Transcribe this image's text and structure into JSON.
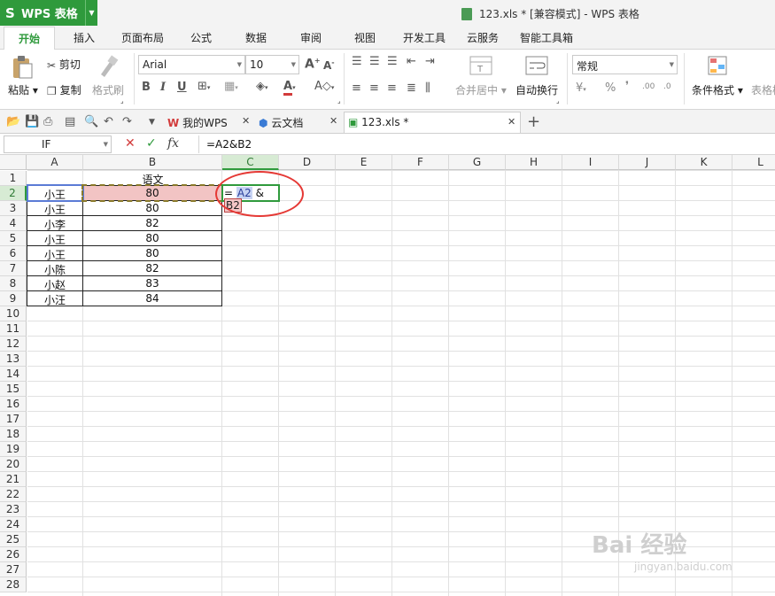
{
  "app": {
    "name": "WPS 表格",
    "logo": "S"
  },
  "window": {
    "title": "123.xls * [兼容模式] - WPS 表格"
  },
  "ribbon_tabs": [
    "开始",
    "插入",
    "页面布局",
    "公式",
    "数据",
    "审阅",
    "视图",
    "开发工具",
    "云服务",
    "智能工具箱"
  ],
  "ribbon": {
    "paste": "粘贴",
    "cut": "剪切",
    "copy": "复制",
    "format_painter": "格式刷",
    "font_name": "Arial",
    "font_size": "10",
    "merge_center": "合并居中",
    "wrap_text": "自动换行",
    "number_format": "常规",
    "conditional_format": "条件格式",
    "table_style": "表格样"
  },
  "doc_tabs": [
    {
      "label": "我的WPS"
    },
    {
      "label": "云文档"
    },
    {
      "label": "123.xls *"
    }
  ],
  "formula_bar": {
    "name_box": "IF",
    "formula": "=A2&B2",
    "fx": "fx"
  },
  "columns": [
    "A",
    "B",
    "C",
    "D",
    "E",
    "F",
    "G",
    "H",
    "I",
    "J",
    "K",
    "L"
  ],
  "rows": [
    "1",
    "2",
    "3",
    "4",
    "5",
    "6",
    "7",
    "8",
    "9",
    "10",
    "11",
    "12",
    "13",
    "14",
    "15",
    "16",
    "17",
    "18",
    "19",
    "20",
    "21",
    "22",
    "23",
    "24",
    "25",
    "26",
    "27",
    "28"
  ],
  "sheet": {
    "header_b1": "语文",
    "names": [
      "小王",
      "小王",
      "小李",
      "小王",
      "小王",
      "小陈",
      "小赵",
      "小汪"
    ],
    "scores": [
      "80",
      "80",
      "82",
      "80",
      "80",
      "82",
      "83",
      "84"
    ],
    "edit_cell": {
      "eq": "=",
      "ref_a": "A2",
      "amp": "&",
      "ref_b": "B2"
    }
  },
  "watermark": {
    "main": "Bai 经验",
    "sub": "jingyan.baidu.com"
  },
  "colors": {
    "accent": "#2f9a3c",
    "ref_a": "#5b7bd5",
    "ref_b": "#f2c4c4",
    "annotation": "#e53935"
  }
}
